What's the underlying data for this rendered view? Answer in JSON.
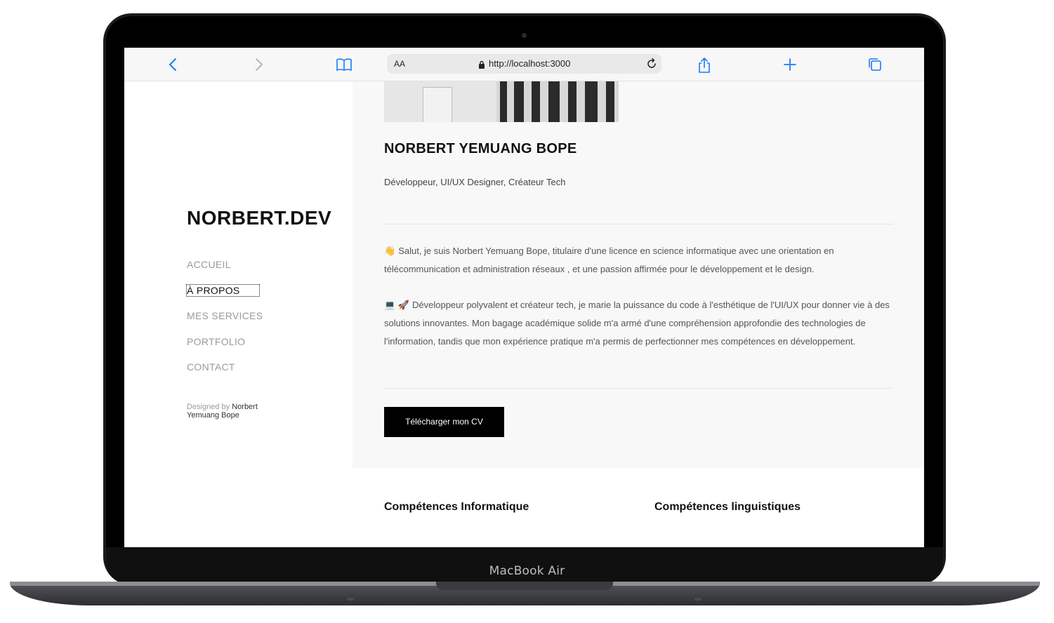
{
  "device": {
    "label": "MacBook Air"
  },
  "browser": {
    "text_size": "AA",
    "url": "http://localhost:3000"
  },
  "site": {
    "logo": "NORBERT.DEV",
    "nav": [
      {
        "label": "ACCUEIL",
        "active": false
      },
      {
        "label": "À PROPOS",
        "active": true
      },
      {
        "label": "MES SERVICES",
        "active": false
      },
      {
        "label": "PORTFOLIO",
        "active": false
      },
      {
        "label": "CONTACT",
        "active": false
      }
    ],
    "credit_prefix": "Designed by",
    "credit_name": "Norbert Yemuang Bope"
  },
  "about": {
    "name": "NORBERT YEMUANG BOPE",
    "subtitle": "Développeur, UI/UX Designer, Créateur Tech",
    "para1_emoji": "👋",
    "para1": "Salut, je suis Norbert Yemuang Bope, titulaire d'une licence en science informatique avec une orientation en télécommunication et administration réseaux , et une passion affirmée pour le développement et le design.",
    "para2_emoji": "💻 🚀",
    "para2": "Développeur polyvalent et créateur tech, je marie la puissance du code à l'esthétique de l'UI/UX pour donner vie à des solutions innovantes. Mon bagage académique solide m'a armé d'une compréhension approfondie des technologies de l'information, tandis que mon expérience pratique m'a permis de perfectionner mes compétences en développement.",
    "cv_button": "Télécharger mon CV"
  },
  "skills": {
    "it_title": "Compétences Informatique",
    "lang_title": "Compétences linguistiques"
  },
  "colors": {
    "accent": "#000000",
    "safari_blue": "#1a7cf5",
    "nav_muted": "#9a9a9a",
    "panel_bg": "#f8f8f8"
  }
}
